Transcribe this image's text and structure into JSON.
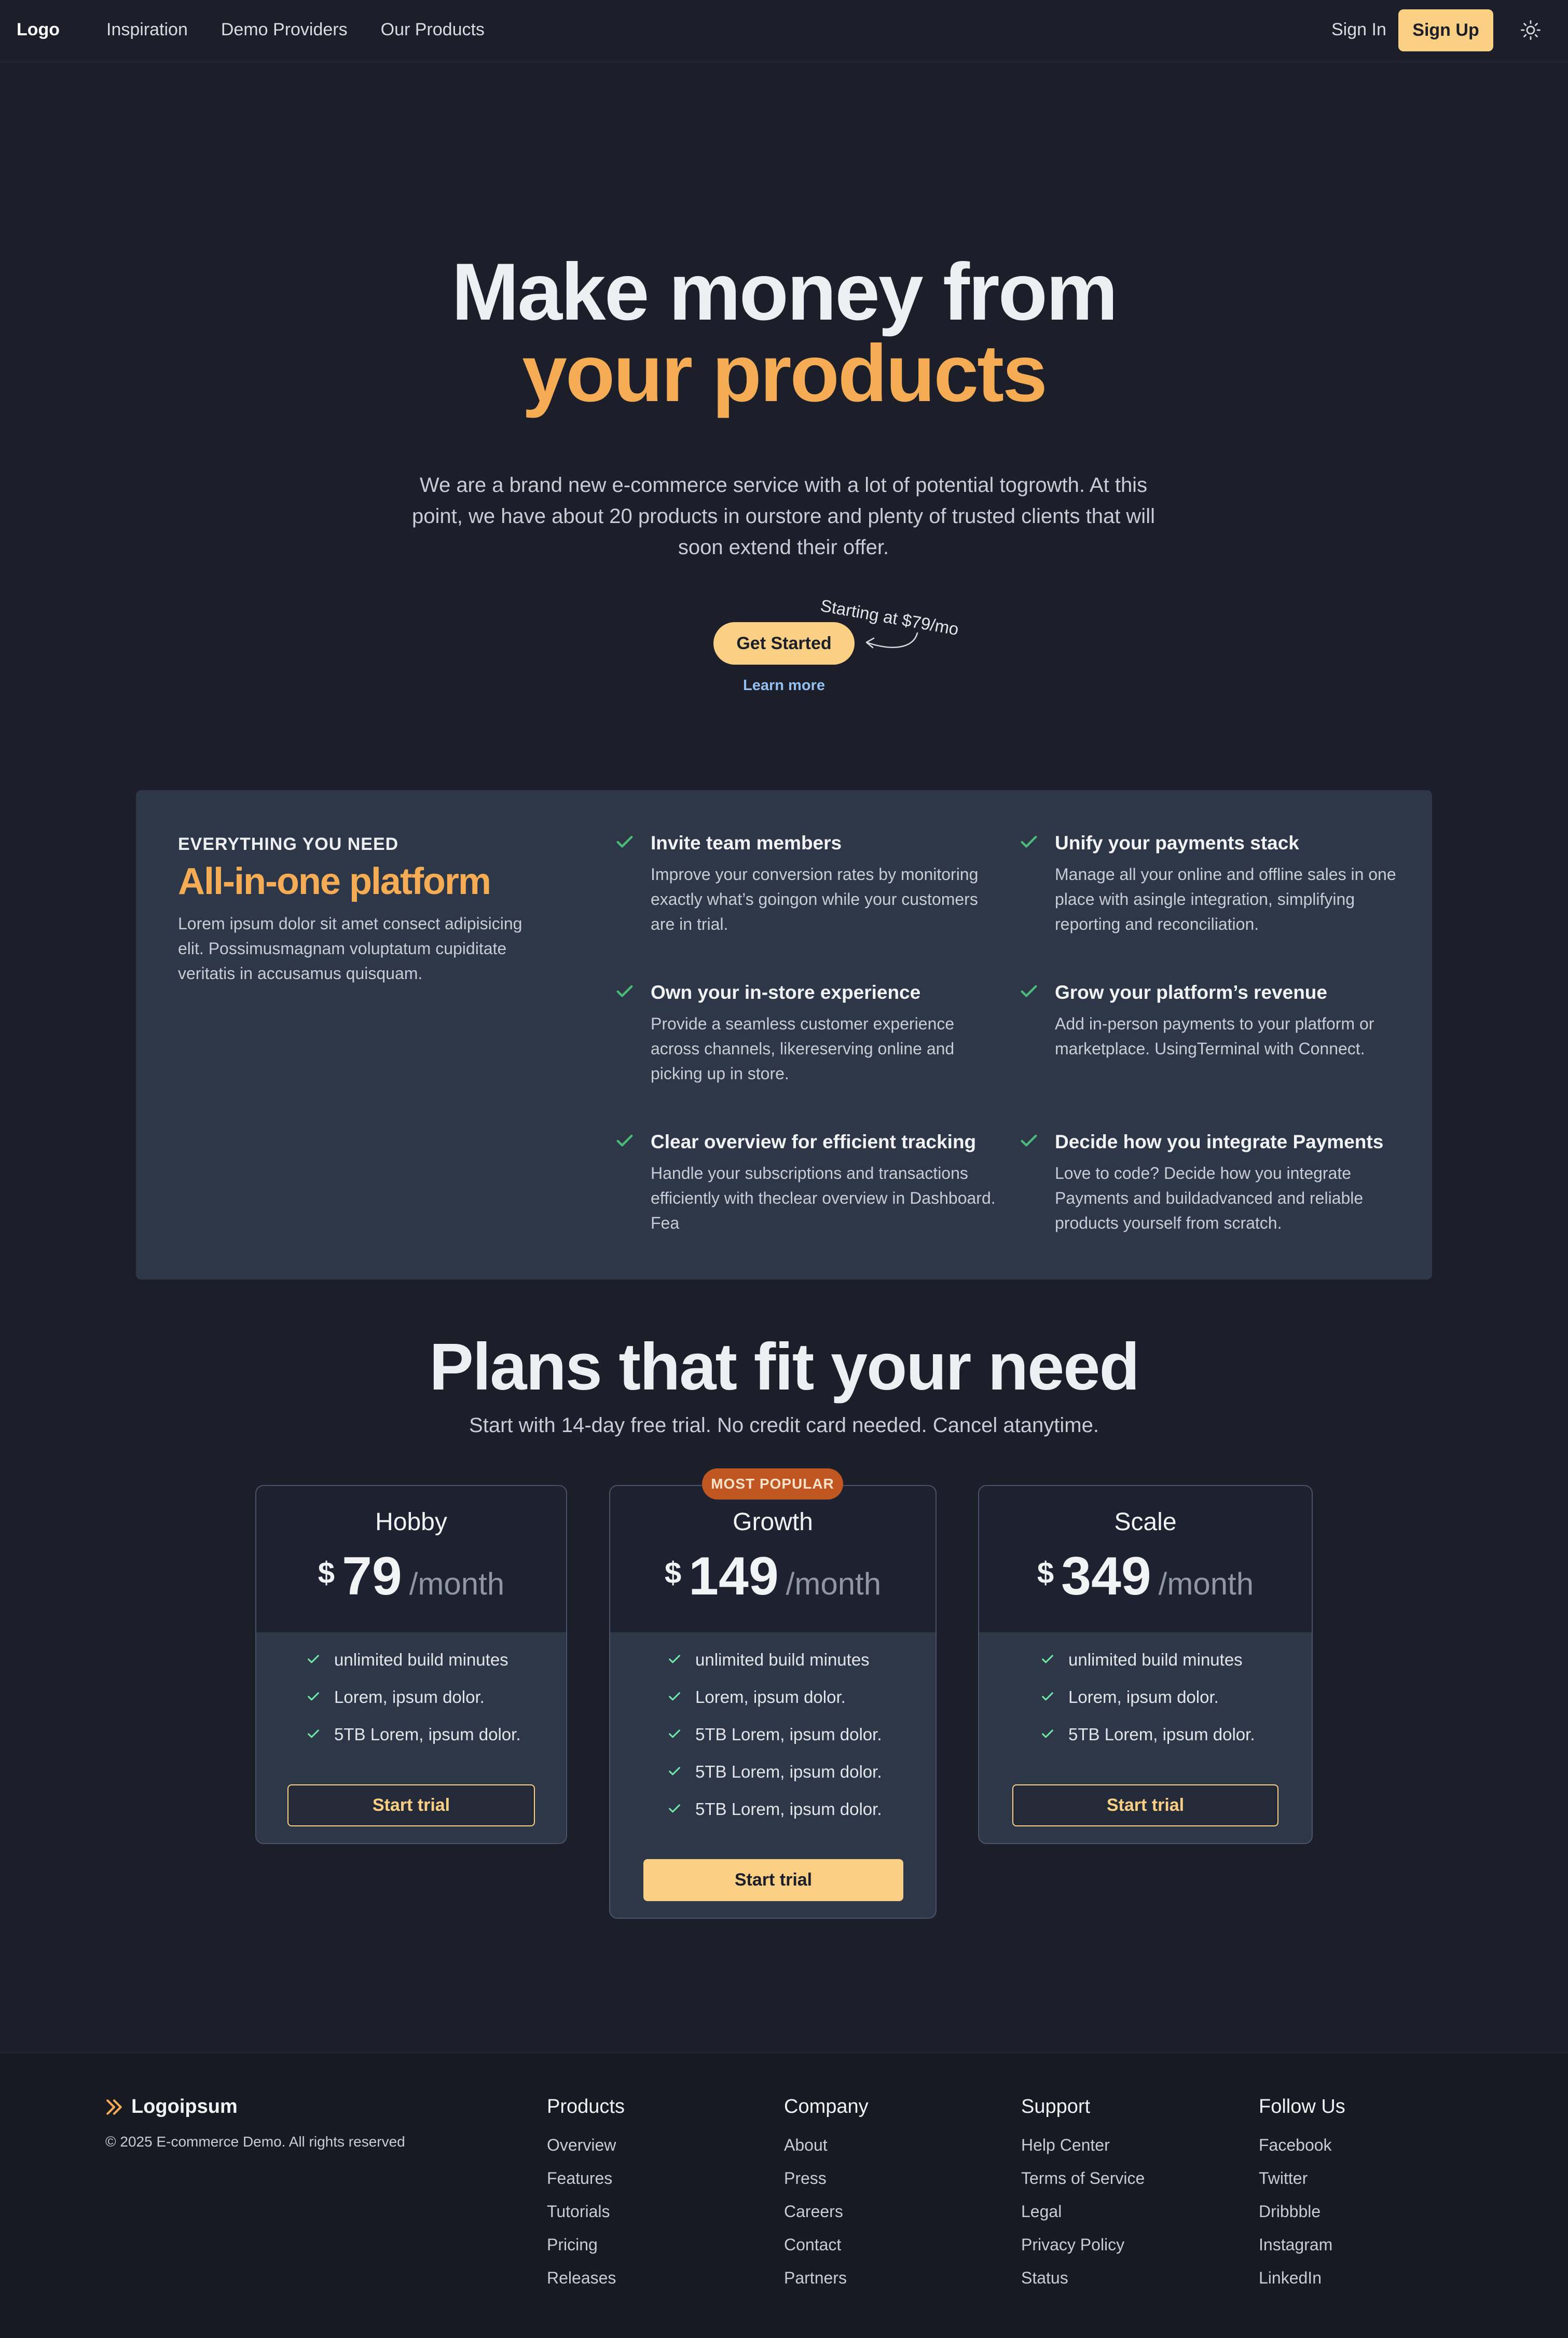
{
  "nav": {
    "logo": "Logo",
    "links": [
      "Inspiration",
      "Demo Providers",
      "Our Products"
    ],
    "sign_in": "Sign In",
    "sign_up": "Sign Up"
  },
  "hero": {
    "title_line1": "Make money from",
    "title_line2": "your products",
    "description": "We are a brand new e-commerce service with a lot of potential togrowth. At this point, we have about 20 products in ourstore and plenty of trusted clients that will soon extend their offer.",
    "starting_note": "Starting at $79/mo",
    "cta": "Get Started",
    "learn_more": "Learn more"
  },
  "features": {
    "eyebrow": "EVERYTHING YOU NEED",
    "title": "All-in-one platform",
    "description": "Lorem ipsum dolor sit amet consect adipisicing elit. Possimusmagnam voluptatum cupiditate veritatis in accusamus quisquam.",
    "items": [
      {
        "title": "Invite team members",
        "text": "Improve your conversion rates by monitoring exactly what’s goingon while your customers are in trial."
      },
      {
        "title": "Unify your payments stack",
        "text": "Manage all your online and offline sales in one place with asingle integration, simplifying reporting and reconciliation."
      },
      {
        "title": "Own your in-store experience",
        "text": "Provide a seamless customer experience across channels, likereserving online and picking up in store."
      },
      {
        "title": "Grow your platform’s revenue",
        "text": "Add in-person payments to your platform or marketplace. UsingTerminal with Connect."
      },
      {
        "title": "Clear overview for efficient tracking",
        "text": "Handle your subscriptions and transactions efficiently with theclear overview in Dashboard. Fea"
      },
      {
        "title": "Decide how you integrate Payments",
        "text": "Love to code? Decide how you integrate Payments and buildadvanced and reliable products yourself from scratch."
      }
    ]
  },
  "plans": {
    "title": "Plans that fit your need",
    "subtitle": "Start with 14-day free trial. No credit card needed. Cancel atanytime.",
    "badge": "MOST POPULAR",
    "cards": [
      {
        "name": "Hobby",
        "currency": "$",
        "amount": "79",
        "period": "/month",
        "features": [
          "unlimited build minutes",
          "Lorem, ipsum dolor.",
          "5TB Lorem, ipsum dolor."
        ],
        "cta": "Start trial"
      },
      {
        "name": "Growth",
        "currency": "$",
        "amount": "149",
        "period": "/month",
        "features": [
          "unlimited build minutes",
          "Lorem, ipsum dolor.",
          "5TB Lorem, ipsum dolor.",
          "5TB Lorem, ipsum dolor.",
          "5TB Lorem, ipsum dolor."
        ],
        "cta": "Start trial"
      },
      {
        "name": "Scale",
        "currency": "$",
        "amount": "349",
        "period": "/month",
        "features": [
          "unlimited build minutes",
          "Lorem, ipsum dolor.",
          "5TB Lorem, ipsum dolor."
        ],
        "cta": "Start trial"
      }
    ]
  },
  "footer": {
    "brand": "Logoipsum",
    "copyright": "© 2025 E-commerce Demo. All rights reserved",
    "columns": [
      {
        "title": "Products",
        "links": [
          "Overview",
          "Features",
          "Tutorials",
          "Pricing",
          "Releases"
        ]
      },
      {
        "title": "Company",
        "links": [
          "About",
          "Press",
          "Careers",
          "Contact",
          "Partners"
        ]
      },
      {
        "title": "Support",
        "links": [
          "Help Center",
          "Terms of Service",
          "Legal",
          "Privacy Policy",
          "Status"
        ]
      },
      {
        "title": "Follow Us",
        "links": [
          "Facebook",
          "Twitter",
          "Dribbble",
          "Instagram",
          "LinkedIn"
        ]
      }
    ]
  },
  "colors": {
    "background": "#1c1e29",
    "accent": "#f5ac55",
    "button": "#fbcf84",
    "panel": "#2d3748",
    "check": "#48bb78",
    "badge": "#c05621"
  },
  "icons": {
    "theme_toggle": "sun-icon",
    "feature_marker": "check-icon",
    "brand_mark": "double-chevron-icon"
  }
}
